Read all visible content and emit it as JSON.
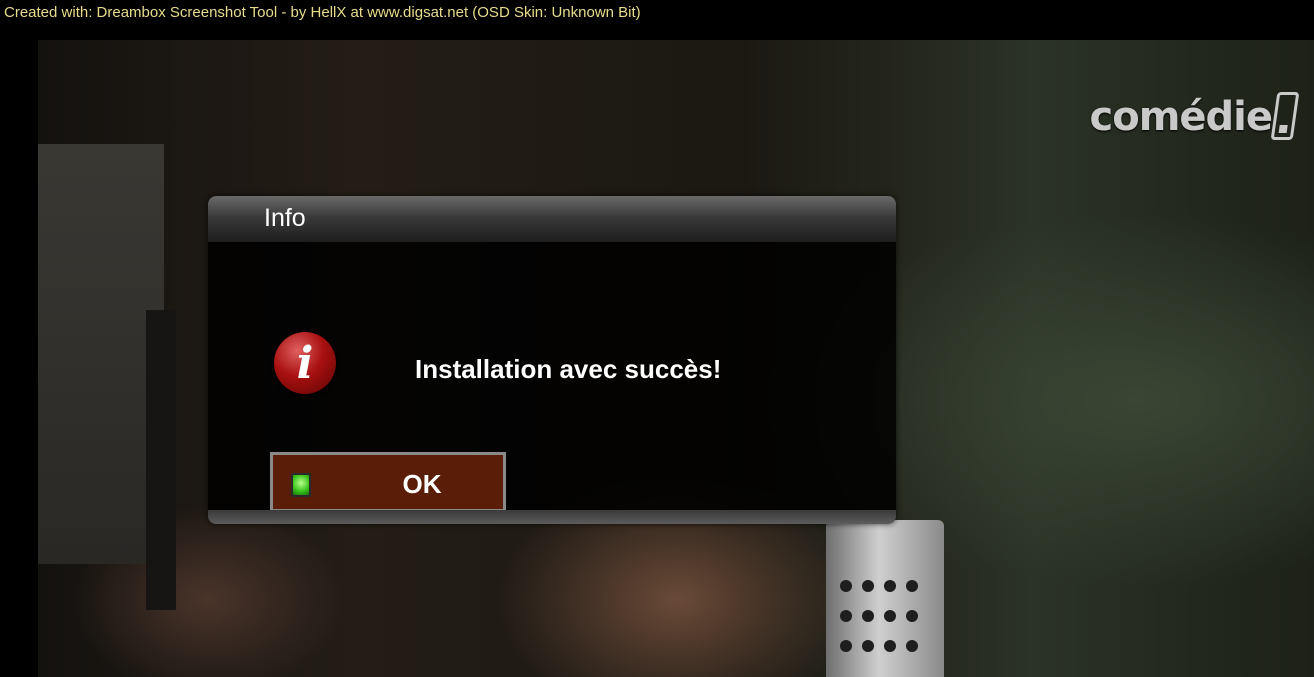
{
  "screenshot_credit": "Created with: Dreambox Screenshot Tool - by HellX at www.digsat.net  (OSD Skin: Unknown Bit)",
  "channel_logo": "comédie",
  "dialog": {
    "title": "Info",
    "message": "Installation avec succès!",
    "icon": "info-icon",
    "ok_label": "OK",
    "ok_indicator": "green-button-icon"
  },
  "colors": {
    "credit_text": "#e8dc8a",
    "button_bg": "#5a1e08",
    "icon_red": "#a81010",
    "indicator_green": "#36c21a"
  }
}
